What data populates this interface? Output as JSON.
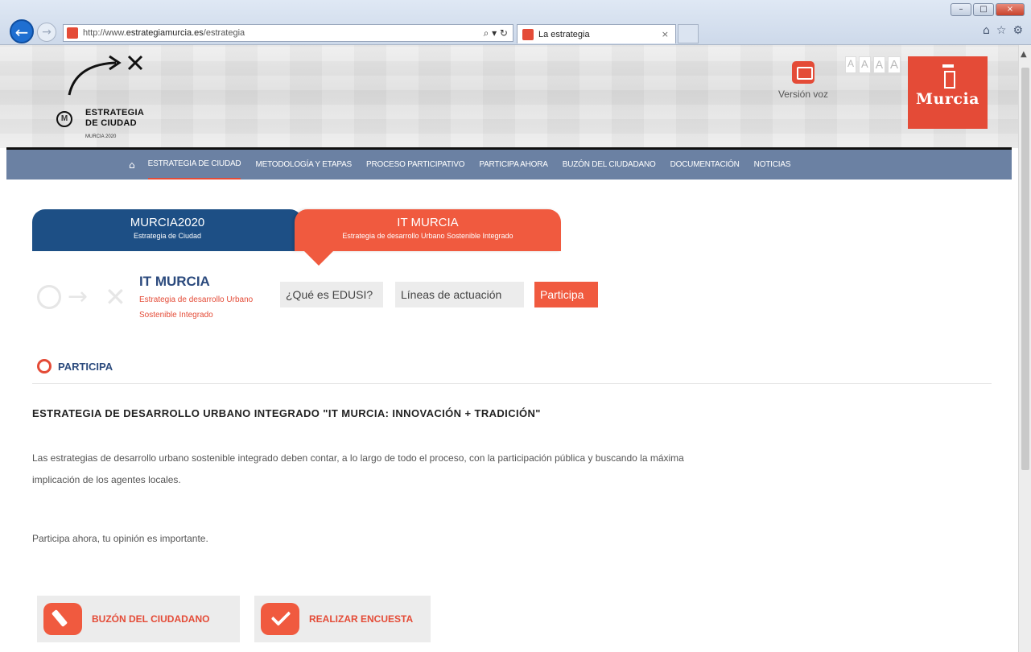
{
  "browser": {
    "url_prefix": "http://www.",
    "url_domain": "estrategiamurcia.es",
    "url_path": "/estrategia",
    "address_tools": "⌕ ▾ ↻",
    "tab_title": "La estrategia",
    "tab_close": "×",
    "back_glyph": "←",
    "forward_glyph": "→",
    "window_minimize": "–",
    "window_maximize": "□",
    "window_close": "×",
    "home_glyph": "⌂",
    "favorites_glyph": "☆",
    "settings_glyph": "⚙"
  },
  "header": {
    "logo_letter": "M",
    "logo_title_line1": "ESTRATEGIA",
    "logo_title_line2": "DE CIUDAD",
    "logo_subtitle": "MURCIA 2020",
    "voice_label": "Versión voz",
    "font_sizes": [
      "A",
      "A",
      "A",
      "A"
    ],
    "city_badge": "Murcia"
  },
  "nav": {
    "home_glyph": "⌂",
    "items": [
      "ESTRATEGIA DE CIUDAD",
      "METODOLOGÍA Y ETAPAS",
      "PROCESO PARTICIPATIVO",
      "PARTICIPA AHORA",
      "BUZÓN DEL CIUDADANO",
      "DOCUMENTACIÓN",
      "NOTICIAS"
    ]
  },
  "tabs": {
    "murcia": {
      "title": "MURCIA2020",
      "subtitle": "Estrategia de Ciudad"
    },
    "it": {
      "title": "IT MURCIA",
      "subtitle": "Estrategia de desarrollo Urbano Sostenible Integrado"
    }
  },
  "section": {
    "deco_arrow": "→",
    "deco_x": "✕",
    "title": "IT MURCIA",
    "subtitle": "Estrategia de desarrollo Urbano Sostenible Integrado",
    "buttons": {
      "que_es": "¿Qué es EDUSI?",
      "lineas": "Líneas de actuación",
      "participa": "Participa"
    }
  },
  "main": {
    "section_label": "PARTICIPA",
    "headline": "ESTRATEGIA DE DESARROLLO URBANO INTEGRADO \"IT MURCIA: INNOVACIÓN + TRADICIÓN\"",
    "paragraph1": "Las estrategias de desarrollo urbano sostenible integrado deben contar, a lo largo de todo el proceso, con la participación pública y buscando la máxima implicación de los agentes locales.",
    "paragraph2": "Participa ahora, tu opinión es importante.",
    "actions": {
      "buzon": "BUZÓN DEL CIUDADANO",
      "encuesta": "REALIZAR ENCUESTA"
    }
  },
  "colors": {
    "accent_red": "#f05a3f",
    "navy": "#1d4f85",
    "nav_bar": "#6b81a3"
  }
}
